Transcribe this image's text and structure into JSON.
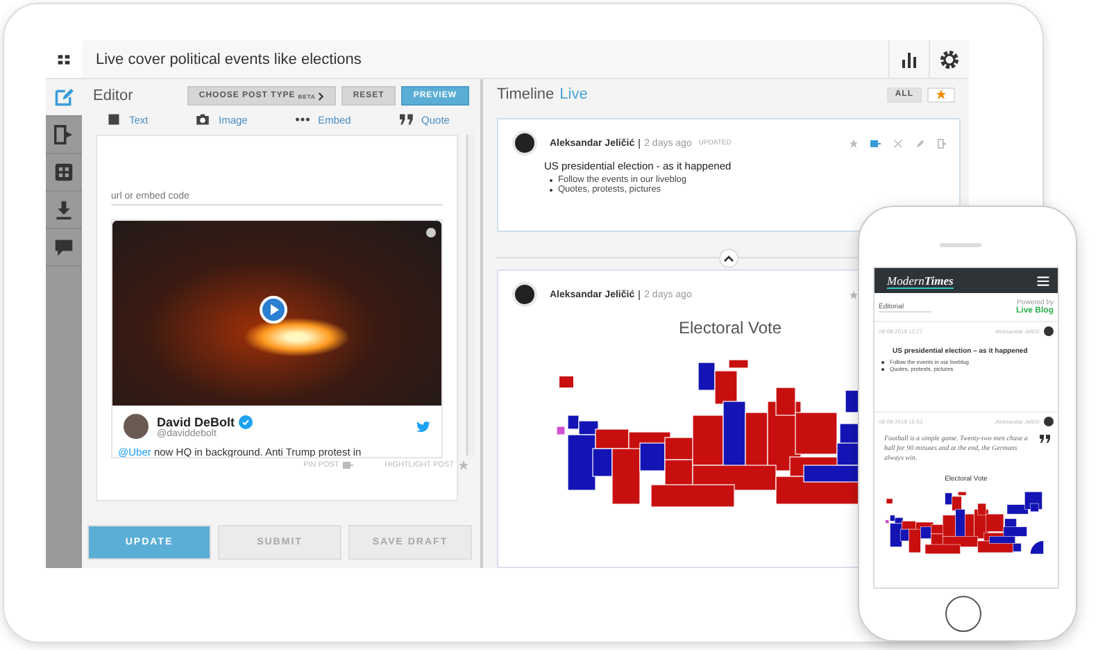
{
  "topbar": {
    "title": "Live cover political events like elections"
  },
  "sidebar": {
    "items": [
      {
        "kind": "edit",
        "selected": true
      },
      {
        "kind": "output",
        "selected": false
      },
      {
        "kind": "layout",
        "selected": false
      },
      {
        "kind": "download",
        "selected": false
      },
      {
        "kind": "comments",
        "selected": false
      }
    ]
  },
  "editor": {
    "title": "Editor",
    "choose_post_type": {
      "label": "CHOOSE POST TYPE",
      "badge": "BETA"
    },
    "reset": "RESET",
    "preview": "PREVIEW",
    "post_types": [
      {
        "kind": "text",
        "label": "Text"
      },
      {
        "kind": "image",
        "label": "Image"
      },
      {
        "kind": "embed",
        "label": "Embed"
      },
      {
        "kind": "quote",
        "label": "Quote"
      }
    ],
    "embed_field": {
      "placeholder": "url or embed code"
    },
    "tweet": {
      "name": "David DeBolt",
      "verified": true,
      "handle": "@daviddebolt",
      "mention": "@Uber",
      "text": "now HQ in background. Anti Trump protest in"
    },
    "pin_post": {
      "label": "PIN POST",
      "on": false
    },
    "highlight_post": {
      "label": "HIGHTLIGHT POST",
      "on": false
    },
    "buttons": [
      {
        "label": "UPDATE",
        "disabled": false
      },
      {
        "label": "SUBMIT",
        "disabled": true
      },
      {
        "label": "SAVE DRAFT",
        "disabled": true
      }
    ]
  },
  "timeline": {
    "title": "Timeline",
    "status": "Live",
    "filters": [
      {
        "kind": "all",
        "label": "ALL",
        "selected": true
      },
      {
        "kind": "starred",
        "selected": false
      }
    ],
    "posts": [
      {
        "author": "Aleksandar Jeličić",
        "time": "2 days ago",
        "updated": "UPDATED",
        "pinned": true,
        "kind": "text",
        "title": "US presidential election - as it happened",
        "bullets": [
          "Follow the events in our liveblog",
          "Quotes, protests, pictures"
        ]
      },
      {
        "author": "Aleksandar Jeličić",
        "time": "2 days ago",
        "kind": "map",
        "map_title": "Electoral Vote"
      }
    ]
  },
  "phone": {
    "brand": "Modern**Times**",
    "filter": "Editorial",
    "powered_by": "Powered by",
    "live_blog": "Live Blog",
    "posts": [
      {
        "kind": "text",
        "date": "08-08-2018 12:27",
        "author": "Aleksandar Jeličić",
        "title": "US presidential election – as it happened",
        "bullets": [
          "Follow the events in our liveblog",
          "Quotes, protests, pictures"
        ]
      },
      {
        "kind": "quote",
        "date": "08-08-2018 15:53",
        "author": "Aleksandar Jeličić",
        "quote": "Football is a simple game. Twenty-two men chase a ball for 90 minutes and at the end, the Germans always win.",
        "map_title": "Electoral Vote"
      }
    ]
  }
}
